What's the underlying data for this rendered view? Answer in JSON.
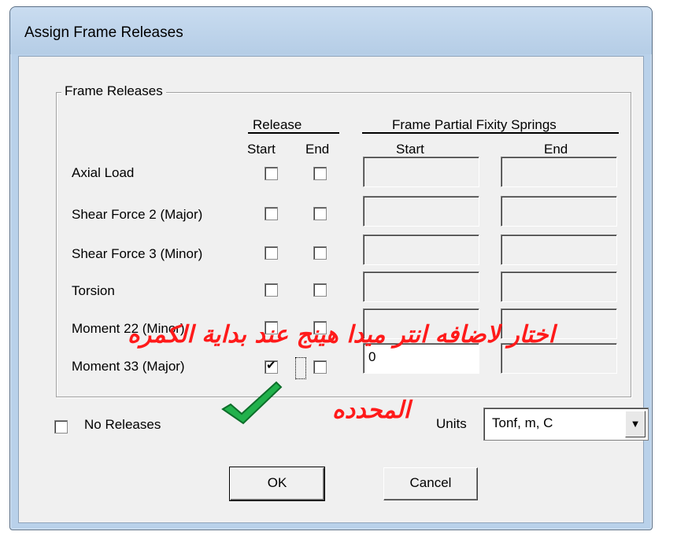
{
  "window": {
    "title": "Assign Frame Releases"
  },
  "group": {
    "label": "Frame Releases"
  },
  "headers": {
    "release": "Release",
    "springs": "Frame Partial Fixity Springs",
    "start": "Start",
    "end": "End",
    "spring_start": "Start",
    "spring_end": "End"
  },
  "rows": [
    {
      "label": "Axial Load",
      "start_checked": false,
      "end_checked": false,
      "spring_start": "",
      "spring_end": ""
    },
    {
      "label": "Shear Force 2 (Major)",
      "start_checked": false,
      "end_checked": false,
      "spring_start": "",
      "spring_end": ""
    },
    {
      "label": "Shear Force 3 (Minor)",
      "start_checked": false,
      "end_checked": false,
      "spring_start": "",
      "spring_end": ""
    },
    {
      "label": "Torsion",
      "start_checked": false,
      "end_checked": false,
      "spring_start": "",
      "spring_end": ""
    },
    {
      "label": "Moment 22 (Minor)",
      "start_checked": false,
      "end_checked": false,
      "spring_start": "",
      "spring_end": ""
    },
    {
      "label": "Moment 33 (Major)",
      "start_checked": true,
      "end_checked": false,
      "spring_start": "0",
      "spring_end": ""
    }
  ],
  "no_releases": {
    "label": "No Releases",
    "checked": false
  },
  "units": {
    "label": "Units",
    "value": "Tonf, m, C"
  },
  "buttons": {
    "ok": "OK",
    "cancel": "Cancel"
  },
  "annotation": {
    "line1": "اختار لاضافه انتر ميدا هينج عند بداية الكمره",
    "line2": "المحدده",
    "color": "#ff1a1a",
    "check_color": "#22b14c"
  }
}
